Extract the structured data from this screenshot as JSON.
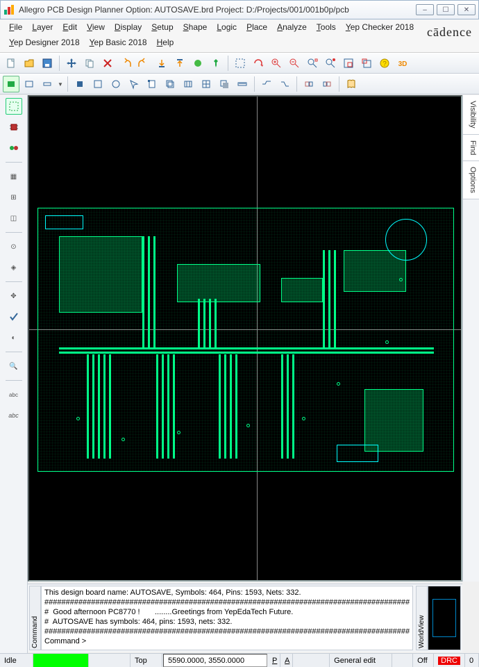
{
  "window": {
    "title": "Allegro PCB Design Planner Option: AUTOSAVE.brd  Project: D:/Projects/001/001b0p/pcb"
  },
  "menus": [
    "File",
    "Layer",
    "Edit",
    "View",
    "Display",
    "Setup",
    "Shape",
    "Logic",
    "Place",
    "Analyze",
    "Tools",
    "Yep Checker 2018",
    "Yep Designer 2018",
    "Yep Basic 2018",
    "Help"
  ],
  "brand": "cādence",
  "toolbar1": {
    "names": [
      "new",
      "open",
      "save",
      "move-pan",
      "copy",
      "delete",
      "undo",
      "redo",
      "step-down",
      "step-up",
      "pell",
      "push-pin",
      "spacer",
      "layer-flip",
      "refresh",
      "zoom-in",
      "zoom-out",
      "zoom-fit",
      "zoom-find",
      "zoom-window",
      "zoom-world",
      "help",
      "3d"
    ]
  },
  "toolbar2": {
    "names": [
      "rect-fill",
      "rect",
      "thin-rect",
      "dropdown",
      "sep",
      "stop",
      "square",
      "circle",
      "arrow",
      "sheet",
      "layers",
      "rect3",
      "grid",
      "shadow",
      "ruler",
      "sep",
      "jog-h",
      "jog-z",
      "sep",
      "prev",
      "next",
      "sep",
      "book"
    ]
  },
  "leftbar_names": [
    "etch",
    "chip",
    "via",
    "sep",
    "constraint",
    "net",
    "pad",
    "sep",
    "pin1",
    "pin2",
    "sep",
    "grabber",
    "checkmark",
    "unknown",
    "sep",
    "search",
    "sep",
    "text-small",
    "text",
    "sep",
    "glyph"
  ],
  "right_tabs": [
    "Visibility",
    "Find",
    "Options"
  ],
  "console": {
    "label": "Command",
    "world_label": "WorldView",
    "lines": [
      "This design board name: AUTOSAVE, Symbols: 464, Pins: 1593, Nets: 332.",
      "######################################################################################",
      "#  Good afternoon PC8770 !       ........Greetings from YepEdaTech Future.",
      "#  AUTOSAVE has symbols: 464, pins: 1593, nets: 332.",
      "######################################################################################",
      "Command >"
    ]
  },
  "status": {
    "mode": "Idle",
    "layer": "Top",
    "coords": "5590.0000, 3550.0000",
    "p": "P",
    "a": "A",
    "edit_mode": "General edit",
    "filter": "Off",
    "drc": "DRC",
    "count": "0"
  }
}
